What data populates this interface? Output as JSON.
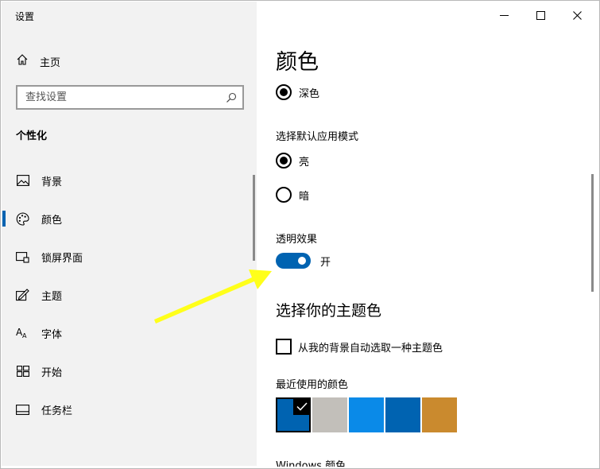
{
  "window": {
    "title": "设置"
  },
  "titlebar": {
    "minimize": "minimize",
    "maximize": "maximize",
    "close": "close"
  },
  "sidebar": {
    "home_label": "主页",
    "search_placeholder": "查找设置",
    "section_title": "个性化",
    "items": [
      {
        "label": "背景",
        "icon": "picture-icon"
      },
      {
        "label": "颜色",
        "icon": "palette-icon",
        "active": true
      },
      {
        "label": "锁屏界面",
        "icon": "lock-screen-icon"
      },
      {
        "label": "主题",
        "icon": "theme-icon"
      },
      {
        "label": "字体",
        "icon": "font-icon"
      },
      {
        "label": "开始",
        "icon": "start-icon"
      },
      {
        "label": "任务栏",
        "icon": "taskbar-icon"
      }
    ]
  },
  "main": {
    "title": "颜色",
    "windows_mode_option": "深色",
    "app_mode_label": "选择默认应用模式",
    "app_mode_options": [
      "亮",
      "暗"
    ],
    "transparency_label": "透明效果",
    "transparency_state": "开",
    "accent_heading": "选择你的主题色",
    "auto_accent_label": "从我的背景自动选取一种主题色",
    "recent_colors_label": "最近使用的颜色",
    "recent_colors": [
      "#0063b1",
      "#c2bfba",
      "#0a8ae8",
      "#0063b1",
      "#ca8a2e"
    ],
    "windows_colors_label": "Windows 颜色"
  },
  "colors": {
    "accent": "#0063b1",
    "arrow": "#ffff1a"
  }
}
